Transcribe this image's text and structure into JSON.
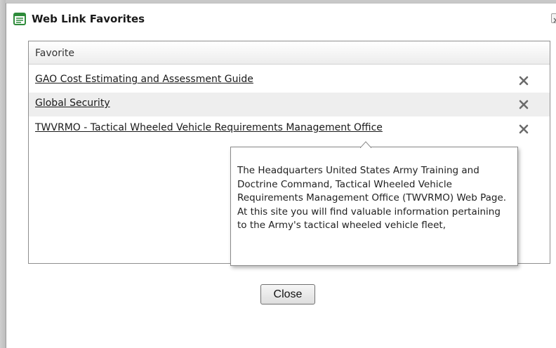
{
  "dialog": {
    "title": "Web Link Favorites",
    "title_icon": "list-document-icon",
    "close_icon": "close-icon"
  },
  "grid": {
    "column_header": "Favorite",
    "rows": [
      {
        "label": "GAO Cost Estimating and Assessment Guide",
        "delete_icon": "delete-x-icon"
      },
      {
        "label": "Global Security",
        "delete_icon": "delete-x-icon"
      },
      {
        "label": "TWVRMO - Tactical Wheeled Vehicle Requirements Management Office",
        "delete_icon": "delete-x-icon"
      }
    ]
  },
  "tooltip": {
    "text": "The Headquarters United States Army Training and Doctrine Command, Tactical Wheeled Vehicle Requirements Management Office (TWVRMO) Web Page. At this site you will find valuable information pertaining to the Army's tactical wheeled vehicle fleet,"
  },
  "footer": {
    "close_label": "Close"
  },
  "colors": {
    "icon_green": "#2e8b3a",
    "delete_x": "#6b6b6b",
    "row_alt": "#eeeeee"
  }
}
